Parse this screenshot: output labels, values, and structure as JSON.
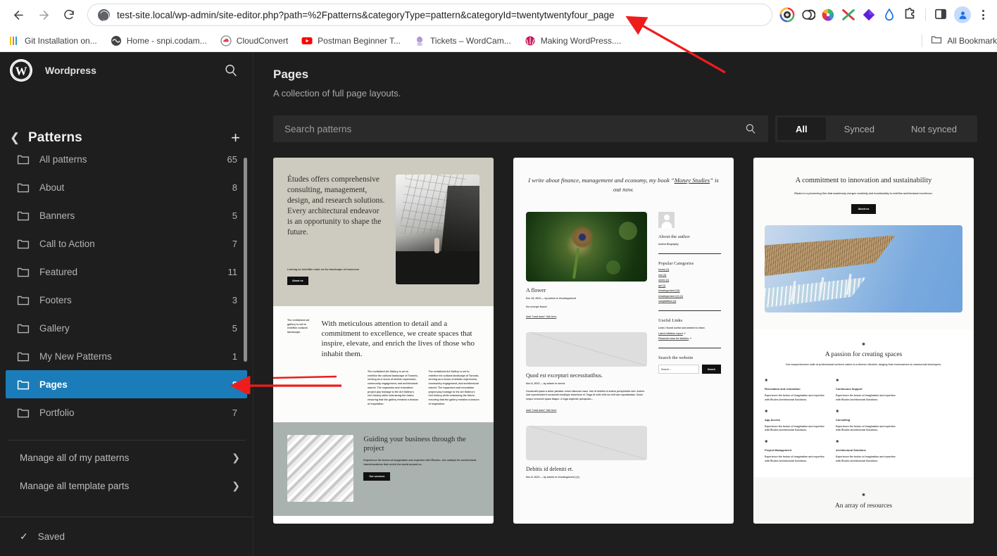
{
  "browser": {
    "url": "test-site.local/wp-admin/site-editor.php?path=%2Fpatterns&categoryType=pattern&categoryId=twentytwentyfour_page",
    "back_icon": "back-arrow-icon",
    "forward_icon": "forward-arrow-icon",
    "reload_icon": "reload-icon",
    "bookmarks": [
      {
        "label": "Git Installation on...",
        "icon": "git-icon"
      },
      {
        "label": "Home - snpi.codam...",
        "icon": "globe-icon"
      },
      {
        "label": "CloudConvert",
        "icon": "cloudconvert-icon"
      },
      {
        "label": "Postman Beginner T...",
        "icon": "youtube-icon"
      },
      {
        "label": "Tickets – WordCam...",
        "icon": "wordcamp-icon"
      },
      {
        "label": "Making WordPress....",
        "icon": "wordpress-icon"
      }
    ],
    "all_bookmarks_label": "All Bookmark",
    "extensions": [
      "colorzilla-icon",
      "loom-icon",
      "colorpicker-icon",
      "xmind-icon",
      "gem-icon",
      "waterdrop-icon",
      "puzzle-extensions-icon"
    ],
    "sidepanel_icon": "side-panel-icon",
    "profile_icon": "profile-avatar-icon",
    "menu_icon": "three-dot-menu-icon"
  },
  "sidebar": {
    "site_title": "Wordpress",
    "logo_icon": "wordpress-logo-icon",
    "search_icon": "search-icon",
    "back_icon": "chevron-left-icon",
    "heading": "Patterns",
    "add_icon": "plus-icon",
    "items": [
      {
        "label": "All patterns",
        "count": "65",
        "active": false
      },
      {
        "label": "About",
        "count": "8",
        "active": false
      },
      {
        "label": "Banners",
        "count": "5",
        "active": false
      },
      {
        "label": "Call to Action",
        "count": "7",
        "active": false
      },
      {
        "label": "Featured",
        "count": "11",
        "active": false
      },
      {
        "label": "Footers",
        "count": "3",
        "active": false
      },
      {
        "label": "Gallery",
        "count": "5",
        "active": false
      },
      {
        "label": "My New Patterns",
        "count": "1",
        "active": false
      },
      {
        "label": "Pages",
        "count": "8",
        "active": true
      },
      {
        "label": "Portfolio",
        "count": "7",
        "active": false
      }
    ],
    "manage": [
      {
        "label": "Manage all of my patterns",
        "arrow": "chevron-right-icon"
      },
      {
        "label": "Manage all template parts",
        "arrow": "chevron-right-icon"
      }
    ],
    "footer": {
      "status": "Saved",
      "icon": "check-icon"
    }
  },
  "main": {
    "title": "Pages",
    "subtitle": "A collection of full page layouts.",
    "search_placeholder": "Search patterns",
    "search_icon": "search-icon",
    "filters": [
      {
        "label": "All",
        "active": true
      },
      {
        "label": "Synced",
        "active": false
      },
      {
        "label": "Not synced",
        "active": false
      }
    ]
  },
  "cards": {
    "card1": {
      "hero_lead": "Études offers comprehensive consulting, management, design, and research solutions. Every architectural endeavor is an opportunity to shape the future.",
      "hero_sub": "Leaving an indelible mark on the landscape of tomorrow.",
      "hero_btn": "About us",
      "white_tiny": "The revitalized art gallery is set to redefine cultural landscape.",
      "white_head": "With meticulous attention to detail and a commitment to excellence, we create spaces that inspire, elevate, and enrich the lives of those who inhabit them.",
      "white_col": "The revitalized Art Gallery is set to redefine the cultural landscape of Toronto, serving as a nexus of artistic expression, community engagement, and architectural marvel. The expansion and renovation project pay homage to the Art Gallery's rich history while embracing the future, ensuring that the gallery remains a beacon of inspiration.",
      "gray_title": "Guiding your business through the project",
      "gray_body": "Experience the fusion of imagination and expertise with Études—the catalyst for architectural transformations that enrich the world around us.",
      "gray_btn": "Our services"
    },
    "card2": {
      "head_pre": "I write about finance, management and economy, my book “",
      "head_link": "Money Studies",
      "head_post": "” is out now.",
      "post1_title": "A flower",
      "post1_meta": "Dec 15, 2023 — by admin in Uncategorized",
      "post1_excerpt": "No excerpt found",
      "post1_link": "Add \"read more\" link here",
      "post2_title": "Quod est excepturi necessitatibus.",
      "post2_meta": "Nov 8, 2023 — by admin in omnis",
      "post2_body": "Occaecati quam a dolor pariatur rerum laborum eaue. Iste id debitis ut autem perspiciatis sint. Autem sint reprehenderit occaecati similique doloribus et. Fuga id velit velit ea velit aut repudiandae. Dolor neque nesciunt quam itaque. A fuga sapiente quisquam...",
      "post2_link": "Add \"read more\" link here",
      "post3_title": "Debitis id deleniti et.",
      "post3_meta": "Nov 8, 2023 — by admin in Uncategorized (@)",
      "widget_author_title": "About the author",
      "widget_author_bio": "Author Biography",
      "widget_cats_title": "Popular Categories",
      "widget_cats": [
        "luxury (1)",
        "non (3)",
        "omnis (1)",
        "qui (1)",
        "Uncategorized (10)",
        "Uncategorized (@) (1)",
        "voluptatibus (2)"
      ],
      "widget_links_title": "Useful Links",
      "widget_links_sub": "Links I found useful and wanted to share.",
      "widget_links": [
        "Latest inflation report",
        "Financial news for families"
      ],
      "widget_search_title": "Search the website",
      "widget_search_ph": "Search...",
      "widget_search_btn": "Search"
    },
    "card3": {
      "h1": "A commitment to innovation and sustainability",
      "sub": "Études is a pioneering firm that seamlessly merges creativity and functionality to redefine architectural excellence.",
      "btn": "About us",
      "h2": "A passion for creating spaces",
      "sub2": "Our comprehensive suite of professional services caters to a diverse clientele, ranging from homeowners to commercial developers.",
      "services": [
        {
          "title": "Renovation and restoration",
          "desc": "Experience the fusion of imagination and expertise with Études Architectural Solutions."
        },
        {
          "title": "Continuous Support",
          "desc": "Experience the fusion of imagination and expertise with Études Architectural Solutions."
        },
        {
          "title": "App Access",
          "desc": "Experience the fusion of imagination and expertise with Études Architectural Solutions."
        },
        {
          "title": "Consulting",
          "desc": "Experience the fusion of imagination and expertise with Études Architectural Solutions."
        },
        {
          "title": "Project Management",
          "desc": "Experience the fusion of imagination and expertise with Études Architectural Solutions."
        },
        {
          "title": "Architectural Solutions",
          "desc": "Experience the fusion of imagination and expertise with Études Architectural Solutions."
        }
      ],
      "h3": "An array of resources"
    }
  },
  "annotations": {
    "arrow_color": "#ee1c1c",
    "arrow_to_url": "url-bar-arrow",
    "arrow_to_pages": "pages-sidebar-arrow"
  }
}
